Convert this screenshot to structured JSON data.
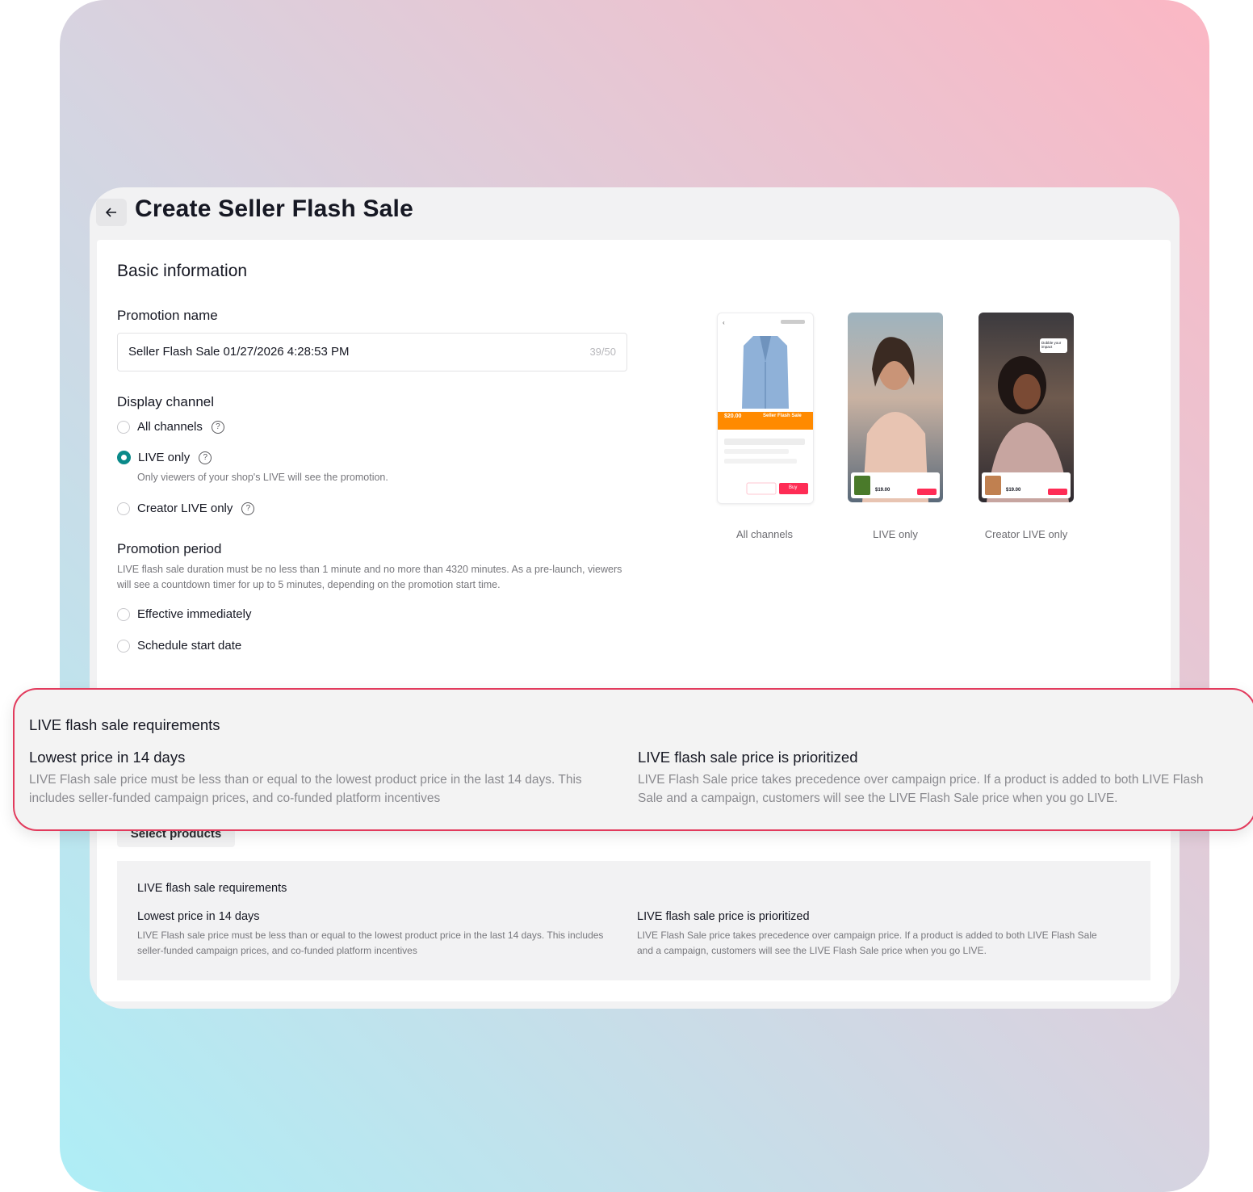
{
  "page": {
    "title": "Create Seller Flash Sale",
    "back_icon": "arrow-left-icon"
  },
  "basic": {
    "section_title": "Basic information",
    "promotion_name_label": "Promotion name",
    "promotion_name_value": "Seller Flash Sale 01/27/2026 4:28:53 PM",
    "promotion_name_count": "39/50"
  },
  "display_channel": {
    "label": "Display channel",
    "options": [
      {
        "label": "All channels",
        "checked": false
      },
      {
        "label": "LIVE only",
        "checked": true,
        "hint": "Only viewers of your shop's LIVE will see the promotion."
      },
      {
        "label": "Creator LIVE only",
        "checked": false
      }
    ]
  },
  "promotion_period": {
    "label": "Promotion period",
    "description": "LIVE flash sale duration must be no less than 1 minute and no more than 4320 minutes. As a pre-launch, viewers will see a countdown timer for up to 5 minutes, depending on the promotion start time.",
    "options": [
      {
        "label": "Effective immediately",
        "checked": false
      },
      {
        "label": "Schedule start date",
        "checked": false
      }
    ]
  },
  "previews": [
    {
      "caption": "All channels",
      "price": "$20.00",
      "banner": "Seller Flash Sale",
      "buy": "Buy"
    },
    {
      "caption": "LIVE only",
      "price": "$19.00"
    },
    {
      "caption": "Creator LIVE only",
      "price": "$19.00",
      "bubble": "Dobble your impact"
    }
  ],
  "products": {
    "select_button": "Select products"
  },
  "requirements": {
    "title": "LIVE flash sale requirements",
    "items": [
      {
        "heading": "Lowest price in 14 days",
        "text": "LIVE Flash sale price must be less than or equal to the lowest product price in the last 14 days. This includes seller-funded campaign prices, and co-funded platform incentives"
      },
      {
        "heading": "LIVE flash sale price is prioritized",
        "text": "LIVE Flash Sale price takes precedence over campaign price. If a product is added to both LIVE Flash Sale and a campaign, customers will see the LIVE Flash Sale price when you go LIVE."
      }
    ]
  },
  "colors": {
    "accent_teal": "#0a8a8a",
    "callout_border": "#e23a5c",
    "banner_orange": "#ff8a00",
    "buy_pink": "#fe2c55"
  }
}
